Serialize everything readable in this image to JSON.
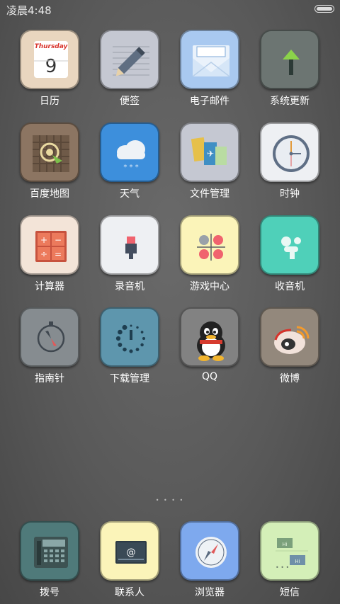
{
  "status": {
    "time": "凌晨4:48"
  },
  "apps": [
    {
      "label": "日历",
      "icon": "calendar-icon",
      "bg": "#e9d6bf",
      "weekday": "Thursday",
      "day": "9"
    },
    {
      "label": "便签",
      "icon": "pencil-notes-icon",
      "bg": "#c5c8d2"
    },
    {
      "label": "电子邮件",
      "icon": "envelope-icon",
      "bg": "#a9c9f0"
    },
    {
      "label": "系统更新",
      "icon": "update-arrow-icon",
      "bg": "#6c7572"
    },
    {
      "label": "百度地图",
      "icon": "map-target-icon",
      "bg": "#8c7562"
    },
    {
      "label": "天气",
      "icon": "cloud-snow-icon",
      "bg": "#3d8fdc"
    },
    {
      "label": "文件管理",
      "icon": "files-icon",
      "bg": "#c5c8d2"
    },
    {
      "label": "时钟",
      "icon": "clock-icon",
      "bg": "#eef0f3"
    },
    {
      "label": "计算器",
      "icon": "calculator-icon",
      "bg": "#f3e4d8"
    },
    {
      "label": "录音机",
      "icon": "microphone-icon",
      "bg": "#eef0f3"
    },
    {
      "label": "游戏中心",
      "icon": "game-dots-icon",
      "bg": "#fbf4b9"
    },
    {
      "label": "收音机",
      "icon": "radio-icon",
      "bg": "#4fd0b9"
    },
    {
      "label": "指南针",
      "icon": "compass-icon",
      "bg": "#868c90"
    },
    {
      "label": "下载管理",
      "icon": "download-spinner-icon",
      "bg": "#5e96ad"
    },
    {
      "label": "QQ",
      "icon": "qq-penguin-icon",
      "bg": "#828282"
    },
    {
      "label": "微博",
      "icon": "weibo-icon",
      "bg": "#93887c"
    }
  ],
  "page_indicator": "• • • •",
  "dock": [
    {
      "label": "拨号",
      "icon": "phone-keypad-icon",
      "bg": "#4f7a7a"
    },
    {
      "label": "联系人",
      "icon": "contact-card-icon",
      "bg": "#fbf4b9"
    },
    {
      "label": "浏览器",
      "icon": "browser-compass-icon",
      "bg": "#7ea9ee"
    },
    {
      "label": "短信",
      "icon": "message-bubbles-icon",
      "bg": "#d4efb8"
    }
  ]
}
